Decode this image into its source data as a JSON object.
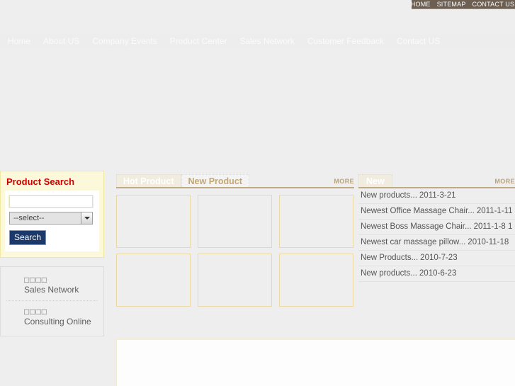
{
  "topbar": {
    "links": [
      {
        "label": "HOME",
        "name": "top-link-home"
      },
      {
        "label": "SITEMAP",
        "name": "top-link-sitemap"
      },
      {
        "label": "CONTACT US",
        "name": "top-link-contact-us"
      }
    ]
  },
  "mainnav": {
    "items": [
      {
        "label": "Home"
      },
      {
        "label": "About US"
      },
      {
        "label": "Company Events"
      },
      {
        "label": "Product Center"
      },
      {
        "label": "Sales Network"
      },
      {
        "label": "Customer Feedback"
      },
      {
        "label": "Contact US"
      }
    ]
  },
  "sidebar": {
    "search": {
      "title": "Product Search",
      "keyword_value": "",
      "keyword_placeholder": "",
      "select_value": "--select--",
      "button_label": "Search"
    },
    "links": [
      {
        "cn": "□□□□",
        "en": "Sales Network"
      },
      {
        "cn": "□□□□",
        "en": "Consulting Online"
      }
    ]
  },
  "center": {
    "tabs": [
      {
        "label": "Hot Product",
        "active": true
      },
      {
        "label": "New Product",
        "active": false
      }
    ],
    "more_label": "MORE",
    "products": [
      {
        "alt": ""
      },
      {
        "alt": ""
      },
      {
        "alt": ""
      },
      {
        "alt": ""
      },
      {
        "alt": ""
      },
      {
        "alt": ""
      }
    ]
  },
  "news": {
    "tab_label": "New",
    "more_label": "MORE",
    "items": [
      {
        "title": "New products...",
        "date": "2011-3-21"
      },
      {
        "title": "Newest Office Massage Chair...",
        "date": "2011-1-11"
      },
      {
        "title": "Newest Boss Massage Chair...",
        "date": "2011-1-8 1"
      },
      {
        "title": "Newest car massage pillow...",
        "date": "2010-11-18"
      },
      {
        "title": "New Products...",
        "date": "2010-7-23"
      },
      {
        "title": "New products...",
        "date": "2010-6-23"
      }
    ]
  },
  "colors": {
    "topbar_bg": "#6d6053",
    "search_panel_bg": "#fcf9da",
    "search_title": "#cc0000",
    "search_button": "#1b3a6b",
    "tab_rule": "#c0aa86",
    "more_link": "#b9a27c",
    "product_border": "#ead9a4",
    "page_bg": "#eeeeee"
  }
}
